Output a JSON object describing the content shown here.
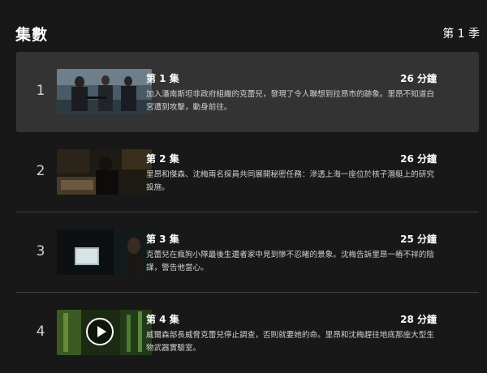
{
  "header": {
    "title": "集數",
    "season": "第 1 季"
  },
  "episodes": [
    {
      "number": "1",
      "title": "第 1 集",
      "duration": "26 分鐘",
      "description": "加入潘南斯坦非政府組織的克蕾兒，發現了令人聯想到拉昂市的跡象。里昂不知道白宮遭到攻擊，動身前往。"
    },
    {
      "number": "2",
      "title": "第 2 集",
      "duration": "26 分鐘",
      "description": "里昂和傑森、沈梅兩名探員共同展開秘密任務：滲透上海一座位於核子潛艇上的研究設施。"
    },
    {
      "number": "3",
      "title": "第 3 集",
      "duration": "25 分鐘",
      "description": "克蕾兒在瘋狗小隊最後生還者家中見到慘不忍睹的景象。沈梅告訴里昂一樁不祥的陰謀，警告他當心。"
    },
    {
      "number": "4",
      "title": "第 4 集",
      "duration": "28 分鐘",
      "description": "威爾森部長威脅克蕾兒停止調查，否則就要她的命。里昂和沈梅趕往地底那座大型生物武器實驗室。"
    }
  ]
}
